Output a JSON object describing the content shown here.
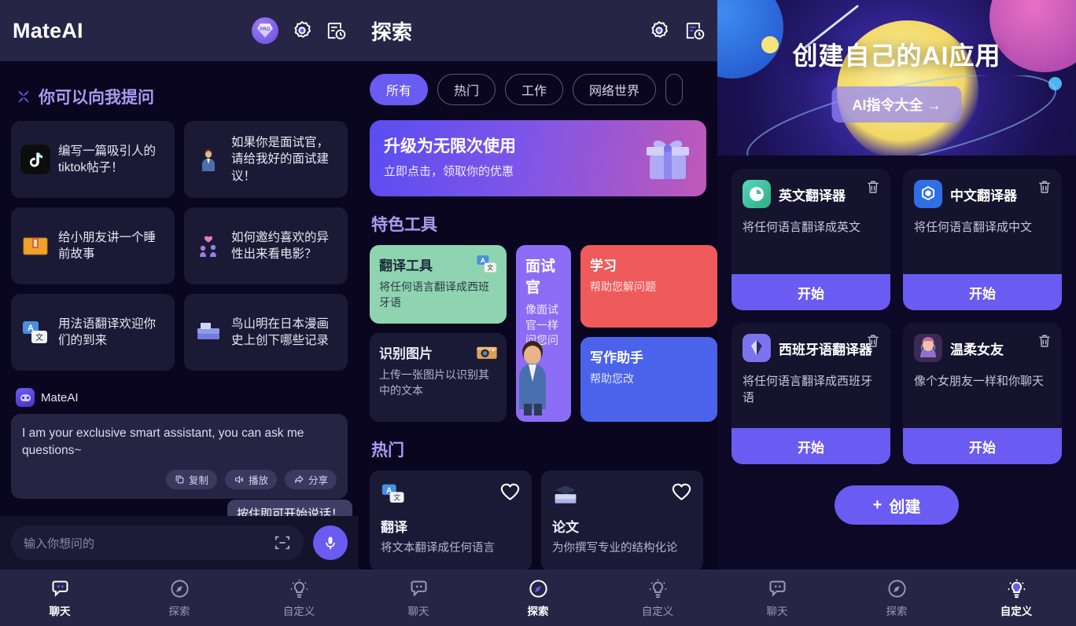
{
  "chat_panel": {
    "header": {
      "title": "MateAI",
      "pro_badge_label": "PRO",
      "icons": [
        "pro-badge-icon",
        "gear-icon",
        "history-icon"
      ]
    },
    "section_title": "你可以向我提问",
    "suggestions": [
      {
        "text": "编写一篇吸引人的tiktok帖子！",
        "icon": "tiktok-icon"
      },
      {
        "text": "如果你是面试官，请给我好的面试建议！",
        "icon": "interviewer-icon"
      },
      {
        "text": "给小朋友讲一个睡前故事",
        "icon": "storybook-icon"
      },
      {
        "text": "如何邀约喜欢的异性出来看电影？",
        "icon": "date-icon"
      },
      {
        "text": "用法语翻译欢迎你们的到来",
        "icon": "translate-icon"
      },
      {
        "text": "鸟山明在日本漫画史上创下哪些记录",
        "icon": "manga-icon"
      }
    ],
    "message": {
      "sender": "MateAI",
      "text": "I am your exclusive smart assistant, you can ask me questions~",
      "actions": [
        {
          "label": "复制",
          "icon": "copy-icon"
        },
        {
          "label": "播放",
          "icon": "speaker-icon"
        },
        {
          "label": "分享",
          "icon": "share-icon"
        }
      ]
    },
    "tooltip": "按住即可开始说话！",
    "input": {
      "placeholder": "输入你想问的",
      "scan_icon": "scan-icon",
      "mic_icon": "microphone-icon"
    },
    "nav": [
      {
        "label": "聊天",
        "icon": "chat-icon",
        "active": true
      },
      {
        "label": "探索",
        "icon": "compass-icon",
        "active": false
      },
      {
        "label": "自定义",
        "icon": "bulb-icon",
        "active": false
      }
    ]
  },
  "explore_panel": {
    "header": {
      "title": "探索",
      "icons": [
        "gear-icon",
        "history-icon"
      ]
    },
    "chips": [
      {
        "label": "所有",
        "active": true
      },
      {
        "label": "热门",
        "active": false
      },
      {
        "label": "工作",
        "active": false
      },
      {
        "label": "网络世界",
        "active": false
      },
      {
        "label": "",
        "active": false
      }
    ],
    "promo": {
      "title": "升级为无限次使用",
      "subtitle": "立即点击，领取你的优惠",
      "icon": "gift-icon"
    },
    "featured_title": "特色工具",
    "featured_tools": [
      {
        "title": "翻译工具",
        "desc": "将任何语言翻译成西班牙语",
        "color": "#8fd4b0",
        "icon": "translate-icon"
      },
      {
        "title": "识别图片",
        "desc": "上传一张图片以识别其中的文本",
        "color": "#1b1a36",
        "icon": "camera-icon"
      },
      {
        "title": "面试官",
        "desc": "像面试官一样问您问题",
        "color": "#8d6cf5",
        "icon": "interviewer-icon"
      },
      {
        "title": "学习",
        "desc": "帮助您解问题",
        "color": "#ef5a5a",
        "icon": "study-icon"
      },
      {
        "title": "写作助手",
        "desc": "帮助您改",
        "color": "#4a63ea",
        "icon": "writing-icon"
      }
    ],
    "hot_title": "热门",
    "hot_items": [
      {
        "title": "翻译",
        "desc": "将文本翻译成任何语言",
        "icon": "translate-icon",
        "fav_icon": "heart-icon"
      },
      {
        "title": "论文",
        "desc": "为你撰写专业的结构化论",
        "icon": "books-icon",
        "fav_icon": "heart-icon"
      }
    ],
    "nav": [
      {
        "label": "聊天",
        "icon": "chat-icon",
        "active": false
      },
      {
        "label": "探索",
        "icon": "compass-icon",
        "active": true
      },
      {
        "label": "自定义",
        "icon": "bulb-icon",
        "active": false
      }
    ]
  },
  "custom_panel": {
    "hero": {
      "title": "创建自己的AI应用",
      "button_label": "AI指令大全  →"
    },
    "apps": [
      {
        "name": "英文翻译器",
        "desc": "将任何语言翻译成英文",
        "start_label": "开始",
        "icon": "english-translator-icon",
        "icon_color": "#35c7a0",
        "delete_icon": "trash-icon"
      },
      {
        "name": "中文翻译器",
        "desc": "将任何语言翻译成中文",
        "start_label": "开始",
        "icon": "chinese-translator-icon",
        "icon_color": "#2f6fe6",
        "delete_icon": "trash-icon"
      },
      {
        "name": "西班牙语翻译器",
        "desc": "将任何语言翻译成西班牙语",
        "start_label": "开始",
        "icon": "spanish-translator-icon",
        "icon_color": "#7c73f0",
        "delete_icon": "trash-icon"
      },
      {
        "name": "温柔女友",
        "desc": "像个女朋友一样和你聊天",
        "start_label": "开始",
        "icon": "girlfriend-avatar-icon",
        "icon_color": "#6a4b8c",
        "delete_icon": "trash-icon"
      }
    ],
    "create_button": {
      "label": "创建",
      "plus": "+"
    },
    "nav": [
      {
        "label": "聊天",
        "icon": "chat-icon",
        "active": false
      },
      {
        "label": "探索",
        "icon": "compass-icon",
        "active": false
      },
      {
        "label": "自定义",
        "icon": "bulb-icon",
        "active": true
      }
    ]
  },
  "colors": {
    "accent": "#6a5bf2",
    "header_bg": "#262546",
    "page_bg": "#0a0620",
    "card_bg": "#1b1a36",
    "section_title": "#a99df0"
  }
}
